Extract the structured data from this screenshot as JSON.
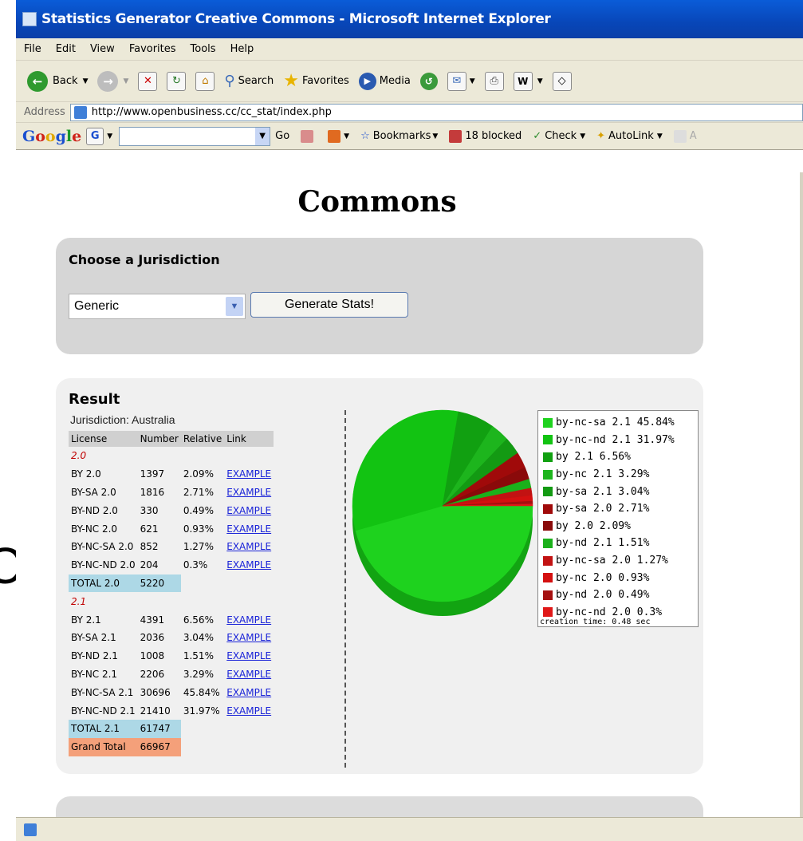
{
  "window": {
    "title": "Statistics Generator Creative Commons - Microsoft Internet Explorer"
  },
  "menu": [
    "File",
    "Edit",
    "View",
    "Favorites",
    "Tools",
    "Help"
  ],
  "toolbar": {
    "back_label": "Back",
    "search_label": "Search",
    "favorites_label": "Favorites",
    "media_label": "Media"
  },
  "address": {
    "label": "Address",
    "url": "http://www.openbusiness.cc/cc_stat/index.php"
  },
  "google_bar": {
    "logo": "Google",
    "go_label": "Go",
    "bookmarks_label": "Bookmarks",
    "blocked_label": "18 blocked",
    "check_label": "Check",
    "autolink_label": "AutoLink",
    "trailing_label": "A"
  },
  "page": {
    "heading": "Commons",
    "jurisdiction_panel": {
      "title": "Choose a Jurisdiction",
      "selected": "Generic",
      "button_label": "Generate Stats!"
    },
    "result": {
      "title": "Result",
      "jurisdiction_line": "Jurisdiction: Australia",
      "headers": [
        "License",
        "Number",
        "Relative",
        "Link"
      ],
      "rows": [
        {
          "type": "version",
          "license": "2.0"
        },
        {
          "type": "data",
          "license": "BY 2.0",
          "number": "1397",
          "relative": "2.09%",
          "link": "EXAMPLE"
        },
        {
          "type": "data",
          "license": "BY-SA 2.0",
          "number": "1816",
          "relative": "2.71%",
          "link": "EXAMPLE"
        },
        {
          "type": "data",
          "license": "BY-ND 2.0",
          "number": "330",
          "relative": "0.49%",
          "link": "EXAMPLE"
        },
        {
          "type": "data",
          "license": "BY-NC 2.0",
          "number": "621",
          "relative": "0.93%",
          "link": "EXAMPLE"
        },
        {
          "type": "data",
          "license": "BY-NC-SA 2.0",
          "number": "852",
          "relative": "1.27%",
          "link": "EXAMPLE"
        },
        {
          "type": "data",
          "license": "BY-NC-ND 2.0",
          "number": "204",
          "relative": "0.3%",
          "link": "EXAMPLE"
        },
        {
          "type": "total",
          "license": "TOTAL 2.0",
          "number": "5220"
        },
        {
          "type": "version",
          "license": "2.1"
        },
        {
          "type": "data",
          "license": "BY 2.1",
          "number": "4391",
          "relative": "6.56%",
          "link": "EXAMPLE"
        },
        {
          "type": "data",
          "license": "BY-SA 2.1",
          "number": "2036",
          "relative": "3.04%",
          "link": "EXAMPLE"
        },
        {
          "type": "data",
          "license": "BY-ND 2.1",
          "number": "1008",
          "relative": "1.51%",
          "link": "EXAMPLE"
        },
        {
          "type": "data",
          "license": "BY-NC 2.1",
          "number": "2206",
          "relative": "3.29%",
          "link": "EXAMPLE"
        },
        {
          "type": "data",
          "license": "BY-NC-SA 2.1",
          "number": "30696",
          "relative": "45.84%",
          "link": "EXAMPLE"
        },
        {
          "type": "data",
          "license": "BY-NC-ND 2.1",
          "number": "21410",
          "relative": "31.97%",
          "link": "EXAMPLE"
        },
        {
          "type": "total",
          "license": "TOTAL 2.1",
          "number": "61747"
        },
        {
          "type": "grand",
          "license": "Grand Total",
          "number": "66967"
        }
      ]
    },
    "creation_time": "creation time: 0.48 sec"
  },
  "colors": {
    "green": "#1ed21e",
    "red": "#e01818",
    "window_blue": "#0846b8",
    "chrome": "#ece9d8",
    "panel": "#d6d6d6"
  },
  "chart_data": {
    "type": "pie",
    "slices": [
      {
        "label": "by-nc-sa 2.1 45.84%",
        "value": 45.84,
        "color": "#1ed21e"
      },
      {
        "label": "by-nc-nd 2.1 31.97%",
        "value": 31.97,
        "color": "#12c312"
      },
      {
        "label": "by 2.1 6.56%",
        "value": 6.56,
        "color": "#11a011"
      },
      {
        "label": "by-nc 2.1 3.29%",
        "value": 3.29,
        "color": "#1db51d"
      },
      {
        "label": "by-sa 2.1 3.04%",
        "value": 3.04,
        "color": "#139a13"
      },
      {
        "label": "by-sa 2.0 2.71%",
        "value": 2.71,
        "color": "#a00a0a"
      },
      {
        "label": "by 2.0 2.09%",
        "value": 2.09,
        "color": "#8a0a0a"
      },
      {
        "label": "by-nd 2.1 1.51%",
        "value": 1.51,
        "color": "#1bb01b"
      },
      {
        "label": "by-nc-sa 2.0 1.27%",
        "value": 1.27,
        "color": "#c21212"
      },
      {
        "label": "by-nc 2.0 0.93%",
        "value": 0.93,
        "color": "#d41010"
      },
      {
        "label": "by-nd 2.0 0.49%",
        "value": 0.49,
        "color": "#a51010"
      },
      {
        "label": "by-nc-nd 2.0 0.3%",
        "value": 0.3,
        "color": "#e01818"
      }
    ]
  }
}
